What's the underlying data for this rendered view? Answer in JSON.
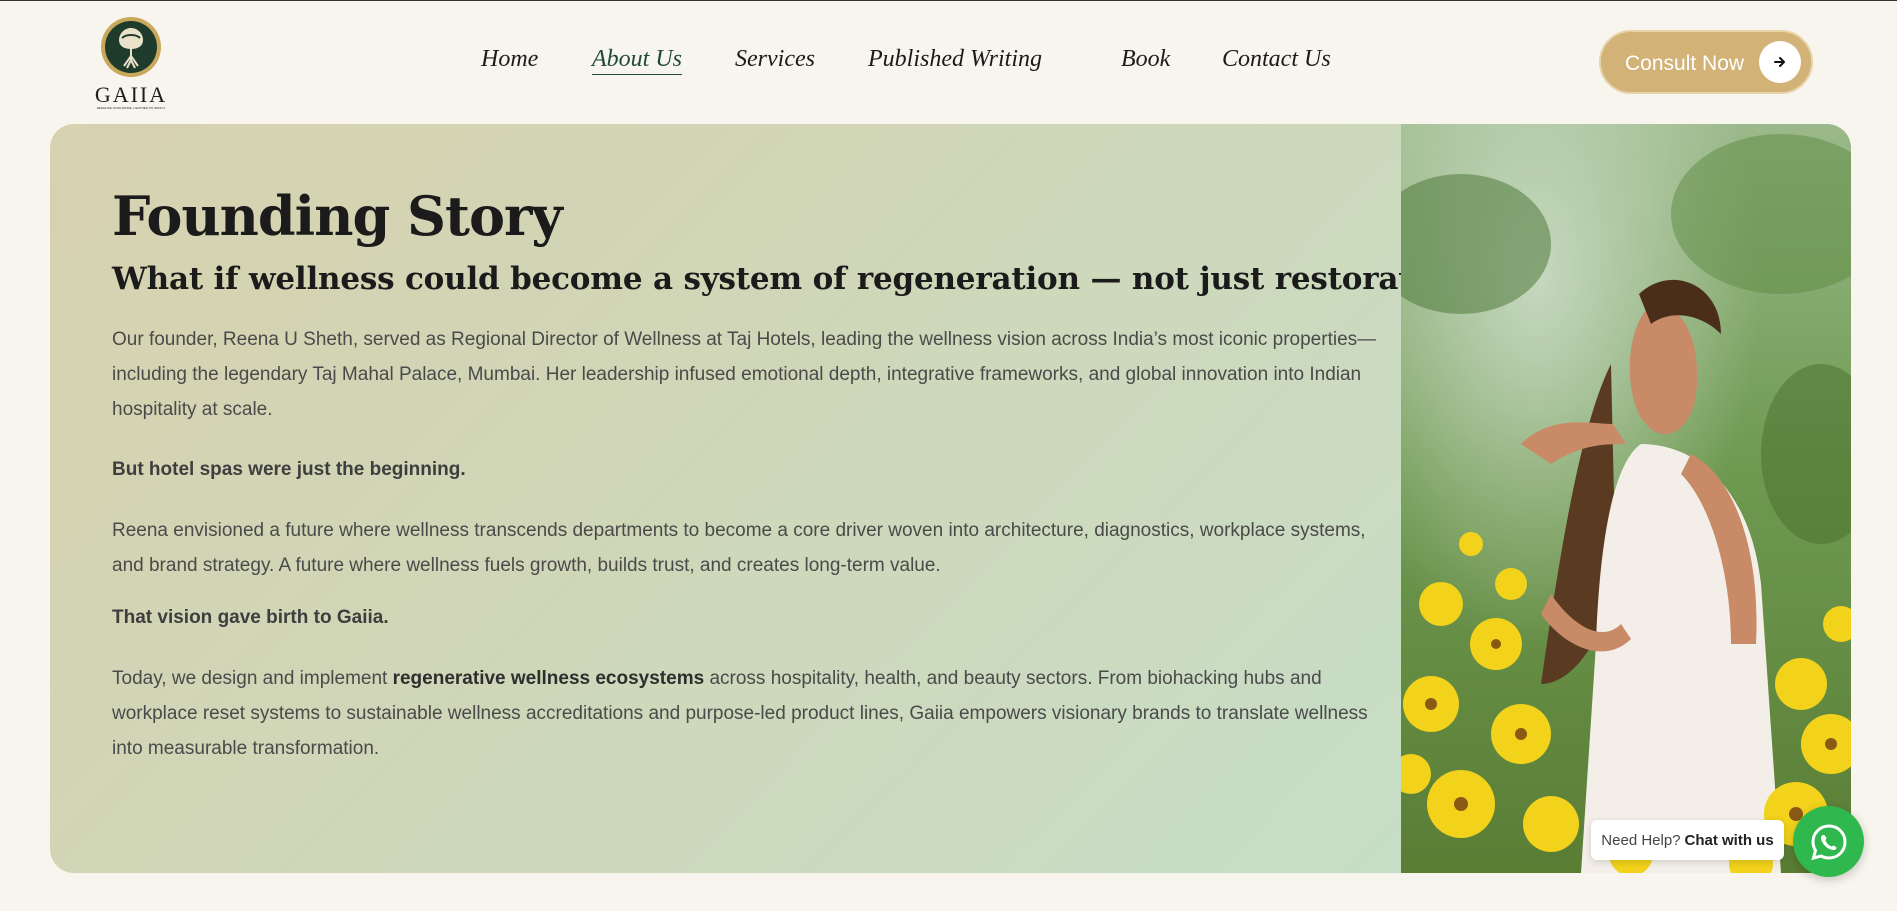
{
  "brand": {
    "logo_text": "GAIIA",
    "logo_tagline": "REDEFINE WORLDWIDE, CENTRED ON IMPACT"
  },
  "nav": {
    "items": [
      {
        "label": "Home",
        "active": false
      },
      {
        "label": "About Us",
        "active": true
      },
      {
        "label": "Services",
        "active": false
      },
      {
        "label": "Published Writing",
        "active": false
      },
      {
        "label": "Book",
        "active": false
      },
      {
        "label": "Contact Us",
        "active": false
      }
    ]
  },
  "cta": {
    "label": "Consult Now",
    "icon": "arrow-right-icon"
  },
  "story": {
    "title": "Founding Story",
    "subtitle": "What if wellness could become a system of regeneration — not just restoration?",
    "para1": "Our founder, Reena U Sheth, served as Regional Director of Wellness at Taj Hotels, leading the wellness vision across India’s most iconic properties—including the legendary Taj Mahal Palace, Mumbai. Her leadership infused emotional depth, integrative frameworks, and global innovation into Indian hospitality at scale.",
    "bold1": "But hotel spas were just the beginning.",
    "para2": "Reena envisioned a future where wellness transcends departments to become a core driver woven into architecture, diagnostics, workplace systems, and brand strategy. A future where wellness fuels growth, builds trust, and creates long-term value.",
    "bold2": "That vision gave birth to Gaiia.",
    "para3_before": "Today, we design and implement ",
    "para3_strong": "regenerative wellness ecosystems",
    "para3_after": " across hospitality, health, and beauty sectors. From biohacking hubs and workplace reset systems to sustainable wellness accreditations and purpose-led product lines, Gaiia empowers visionary brands to translate wellness into measurable transformation."
  },
  "chat": {
    "prefix": "Need Help?",
    "action": "Chat with us",
    "icon": "whatsapp-icon"
  },
  "colors": {
    "background": "#f8f4ee",
    "accent_gold": "#d2b276",
    "nav_active": "#1f4a3a",
    "whatsapp_green": "#2fb84d"
  }
}
